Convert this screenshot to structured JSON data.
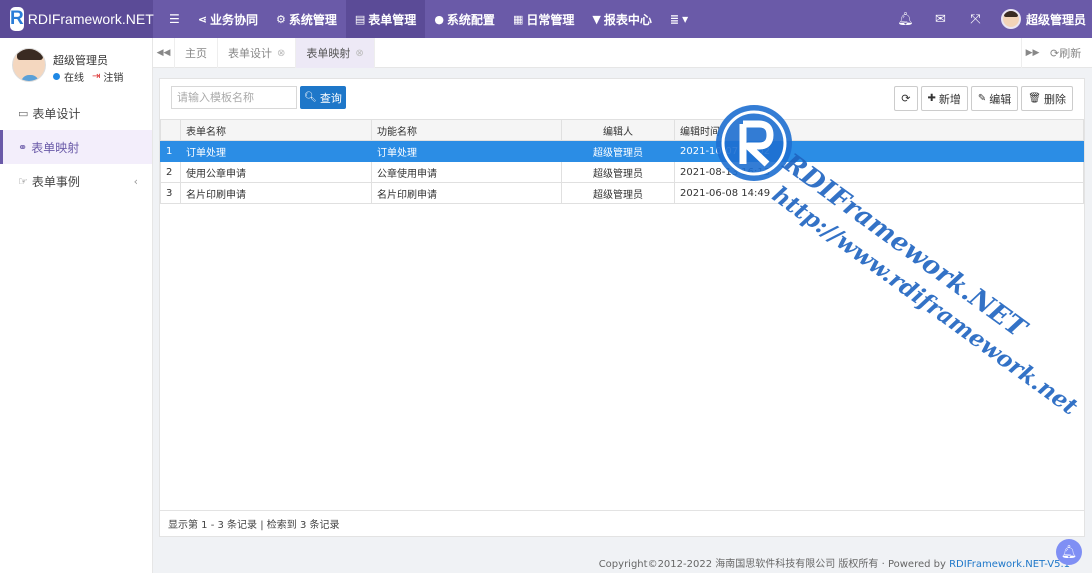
{
  "brand": {
    "logo_letter": "R",
    "name": "RDIFramework.NET"
  },
  "topnav": {
    "menu_icon": "bars-icon",
    "items": [
      {
        "icon": "share-icon",
        "label": "业务协同"
      },
      {
        "icon": "cogs-icon",
        "label": "系统管理"
      },
      {
        "icon": "form-icon",
        "label": "表单管理"
      },
      {
        "icon": "circle-icon",
        "label": "系统配置"
      },
      {
        "icon": "calendar-icon",
        "label": "日常管理"
      },
      {
        "icon": "filter-icon",
        "label": "报表中心"
      },
      {
        "icon": "list-icon",
        "label": "▾"
      }
    ],
    "active_index": 2,
    "user_name": "超级管理员"
  },
  "sidebar": {
    "profile_name": "超级管理员",
    "status": "在线",
    "logout": "注销",
    "items": [
      {
        "icon": "form-icon",
        "label": "表单设计"
      },
      {
        "icon": "link-icon",
        "label": "表单映射"
      },
      {
        "icon": "hand-pointer-icon",
        "label": "表单事例"
      }
    ],
    "active_index": 1
  },
  "tabs": {
    "items": [
      {
        "label": "主页",
        "closable": false
      },
      {
        "label": "表单设计",
        "closable": true
      },
      {
        "label": "表单映射",
        "closable": true
      }
    ],
    "active_index": 2,
    "refresh_label": "刷新"
  },
  "search": {
    "placeholder": "请输入模板名称",
    "value": "",
    "button_label": "查询"
  },
  "toolbar": {
    "add": "新增",
    "edit": "编辑",
    "delete": "删除"
  },
  "table": {
    "headers": [
      "",
      "表单名称",
      "功能名称",
      "编辑人",
      "编辑时间"
    ],
    "rows": [
      {
        "idx": "1",
        "form": "订单处理",
        "func": "订单处理",
        "editor": "超级管理员",
        "time": "2021-10-07 17:02"
      },
      {
        "idx": "2",
        "form": "使用公章申请",
        "func": "公章使用申请",
        "editor": "超级管理员",
        "time": "2021-08-13 16:13"
      },
      {
        "idx": "3",
        "form": "名片印刷申请",
        "func": "名片印刷申请",
        "editor": "超级管理员",
        "time": "2021-06-08 14:49"
      }
    ],
    "selected_index": 0,
    "footer": "显示第 1 - 3 条记录 | 检索到 3 条记录"
  },
  "copyright": {
    "text": "Copyright©2012-2022 海南国思软件科技有限公司 版权所有 · Powered by ",
    "link": "RDIFramework.NET-V5.1"
  },
  "watermark": {
    "line1": "RDIFramework.NET",
    "line2": "http://www.rdiframework.net"
  },
  "colors": {
    "header": "#6a5aa8",
    "accent": "#1e77c9",
    "selected_row": "#2b8de5"
  }
}
